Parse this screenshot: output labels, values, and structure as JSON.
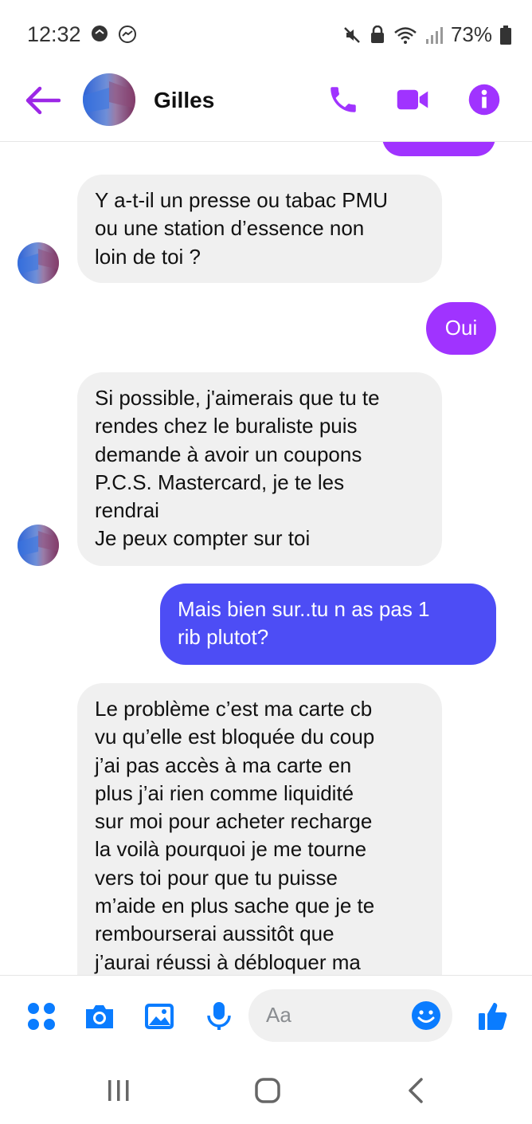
{
  "status": {
    "time": "12:32",
    "battery": "73%"
  },
  "header": {
    "contact_name": "Gilles"
  },
  "messages": [
    {
      "from": "contact",
      "text": "Y a-t-il un presse ou tabac PMU\nou une station d’essence non\nloin de toi ?"
    },
    {
      "from": "me",
      "text": "Oui"
    },
    {
      "from": "contact",
      "text": "Si possible, j'aimerais que tu te\nrendes chez le buraliste puis\ndemande à avoir  un coupons\nP.C.S. Mastercard, je te les\nrendrai\nJe peux compter sur toi"
    },
    {
      "from": "me",
      "text": "Mais bien sur..tu n as pas 1\nrib plutot?"
    },
    {
      "from": "contact",
      "text": "Le problème c’est ma carte cb\nvu qu’elle est bloquée du coup\nj’ai pas accès à ma carte  en\nplus j’ai rien comme liquidité\nsur moi pour acheter recharge\nla voilà pourquoi je me tourne\nvers toi pour que tu puisse\nm’aide en plus sache que je te\nrembourserai aussitôt que\nj’aurai réussi à débloquer ma"
    }
  ],
  "composer": {
    "placeholder": "Aa"
  },
  "colors": {
    "accent": "#a033ff",
    "blue_bubble": "#4d4df5",
    "incoming_bubble": "#f0f0f0",
    "icon_blue": "#0a7cff"
  }
}
